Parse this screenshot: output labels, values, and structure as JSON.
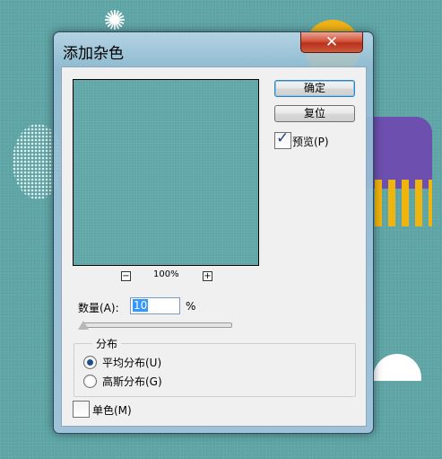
{
  "window": {
    "title": "添加杂色",
    "close_icon": "close-icon"
  },
  "preview": {
    "zoom_out": "−",
    "zoom_in": "+",
    "zoom": "100%"
  },
  "buttons": {
    "ok": "确定",
    "reset": "复位"
  },
  "preview_toggle": {
    "label": "预览(P)",
    "checked": true
  },
  "amount": {
    "label": "数量(A):",
    "value": "10",
    "unit": "%"
  },
  "distribution": {
    "title": "分布",
    "options": [
      {
        "label": "平均分布(U)",
        "selected": true
      },
      {
        "label": "高斯分布(G)",
        "selected": false
      }
    ]
  },
  "monochromatic": {
    "label": "单色(M)",
    "checked": false
  },
  "colors": {
    "accent": "#3399ff",
    "close": "#c4412a",
    "background": "#5fa6a7"
  }
}
